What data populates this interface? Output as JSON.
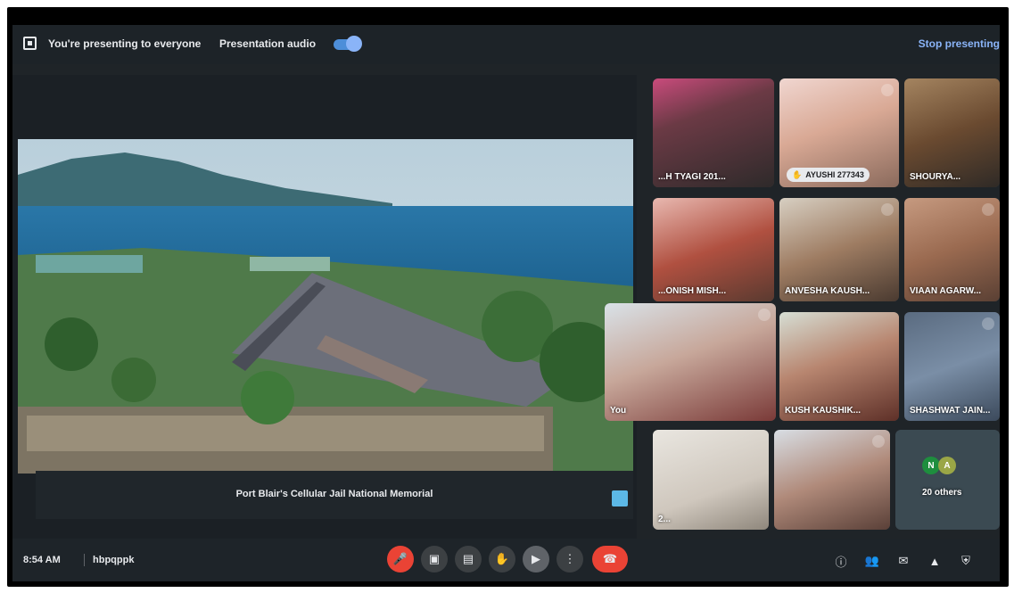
{
  "topbar": {
    "presenting_text": "You're presenting to everyone",
    "audio_label": "Presentation audio",
    "stop_label": "Stop presenting"
  },
  "presentation": {
    "caption": "Port Blair's Cellular Jail National Memorial"
  },
  "participants": [
    {
      "name": "...H TYAGI 201..."
    },
    {
      "name": "AYUSHI 277343",
      "hand_raised": true
    },
    {
      "name": "SHOURYA..."
    },
    {
      "name": "...ONISH MISH..."
    },
    {
      "name": "ANVESHA KAUSH..."
    },
    {
      "name": "VIAAN AGARW..."
    },
    {
      "name": "You"
    },
    {
      "name": "KUSH KAUSHIK..."
    },
    {
      "name": "SHASHWAT JAIN..."
    },
    {
      "name": "2..."
    },
    {
      "name": ""
    },
    {
      "name": "20 others",
      "avatars": [
        "N",
        "A"
      ]
    }
  ],
  "bottombar": {
    "time": "8:54 AM",
    "meeting_code": "hbpqppk"
  },
  "colors": {
    "accent": "#8ab4f8",
    "danger": "#ea4335"
  }
}
